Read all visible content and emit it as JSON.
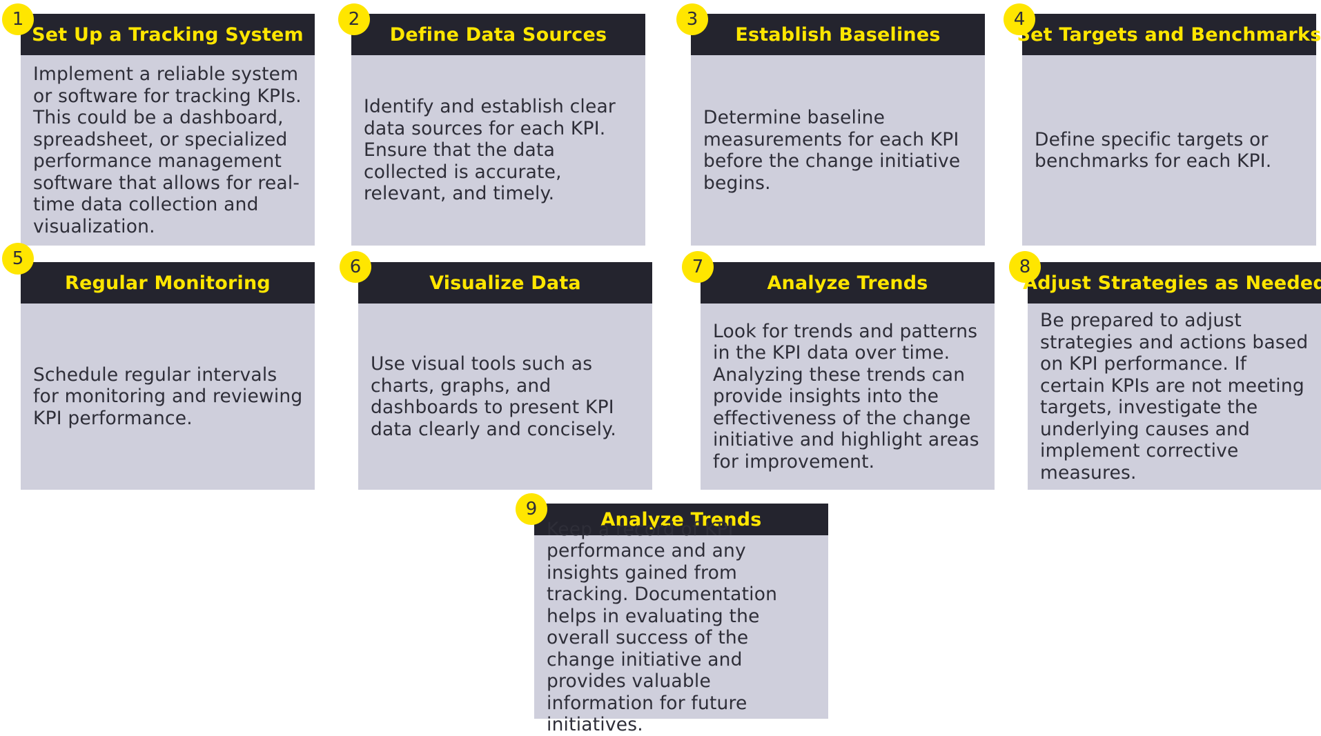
{
  "colors": {
    "header_bg": "#24242e",
    "title_text": "#ffe600",
    "card_bg": "#cfcfdc",
    "badge_bg": "#ffe600",
    "body_text": "#2e2e38"
  },
  "steps": [
    {
      "number": "1",
      "title": "Set Up a Tracking System",
      "description": "Implement a reliable system or software for tracking KPIs. This could be a dashboard, spreadsheet, or specialized performance management software that allows for real-time data collection and visualization."
    },
    {
      "number": "2",
      "title": "Define Data Sources",
      "description": "Identify and establish clear data sources for each KPI. Ensure that the data collected is accurate, relevant, and timely."
    },
    {
      "number": "3",
      "title": "Establish Baselines",
      "description": "Determine baseline measurements for each KPI before the change initiative begins."
    },
    {
      "number": "4",
      "title": "Set Targets and Benchmarks",
      "description": "Define specific targets or benchmarks for each KPI."
    },
    {
      "number": "5",
      "title": "Regular Monitoring",
      "description": "Schedule regular intervals for monitoring and reviewing KPI performance."
    },
    {
      "number": "6",
      "title": "Visualize Data",
      "description": "Use visual tools such as charts, graphs, and dashboards to present KPI data clearly and concisely."
    },
    {
      "number": "7",
      "title": "Analyze Trends",
      "description": "Look for trends and patterns in the KPI data over time. Analyzing these trends can provide insights into the effectiveness of the change initiative and highlight areas for improvement."
    },
    {
      "number": "8",
      "title": "Adjust Strategies as Needed",
      "description": "Be prepared to adjust strategies and actions based on KPI performance. If certain KPIs are not meeting targets, investigate the underlying causes and implement corrective measures."
    },
    {
      "number": "9",
      "title": "Analyze Trends",
      "description": "Keep a record of KPI performance and any insights gained from tracking. Documentation helps in evaluating the overall success of the change initiative and provides valuable information for future initiatives."
    }
  ]
}
